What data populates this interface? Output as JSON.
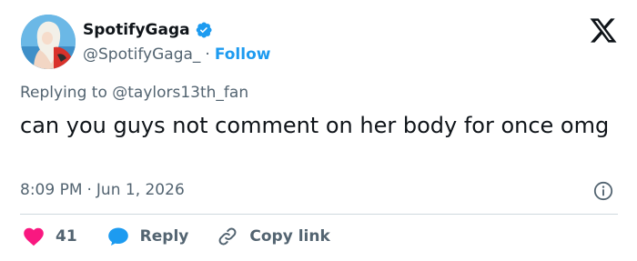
{
  "author": {
    "display_name": "SpotifyGaga",
    "handle": "@SpotifyGaga_",
    "separator": "·",
    "follow_label": "Follow"
  },
  "reply_to": {
    "prefix": "Replying to",
    "mention": "@taylors13th_fan"
  },
  "tweet": {
    "text": "can you guys not comment on her body for once omg",
    "time": "8:09 PM",
    "separator": "·",
    "date": "Jun 1, 2026"
  },
  "actions": {
    "like_count": "41",
    "reply_label": "Reply",
    "copy_link_label": "Copy link"
  },
  "colors": {
    "accent": "#1d9bf0",
    "like": "#f91880",
    "secondary_text": "#536471",
    "divider": "#cfd9de"
  },
  "icons": {
    "verified": "verified-badge-icon",
    "brand": "x-logo-icon",
    "info": "info-icon",
    "like": "heart-icon",
    "reply": "speech-bubble-icon",
    "copy": "link-icon"
  }
}
